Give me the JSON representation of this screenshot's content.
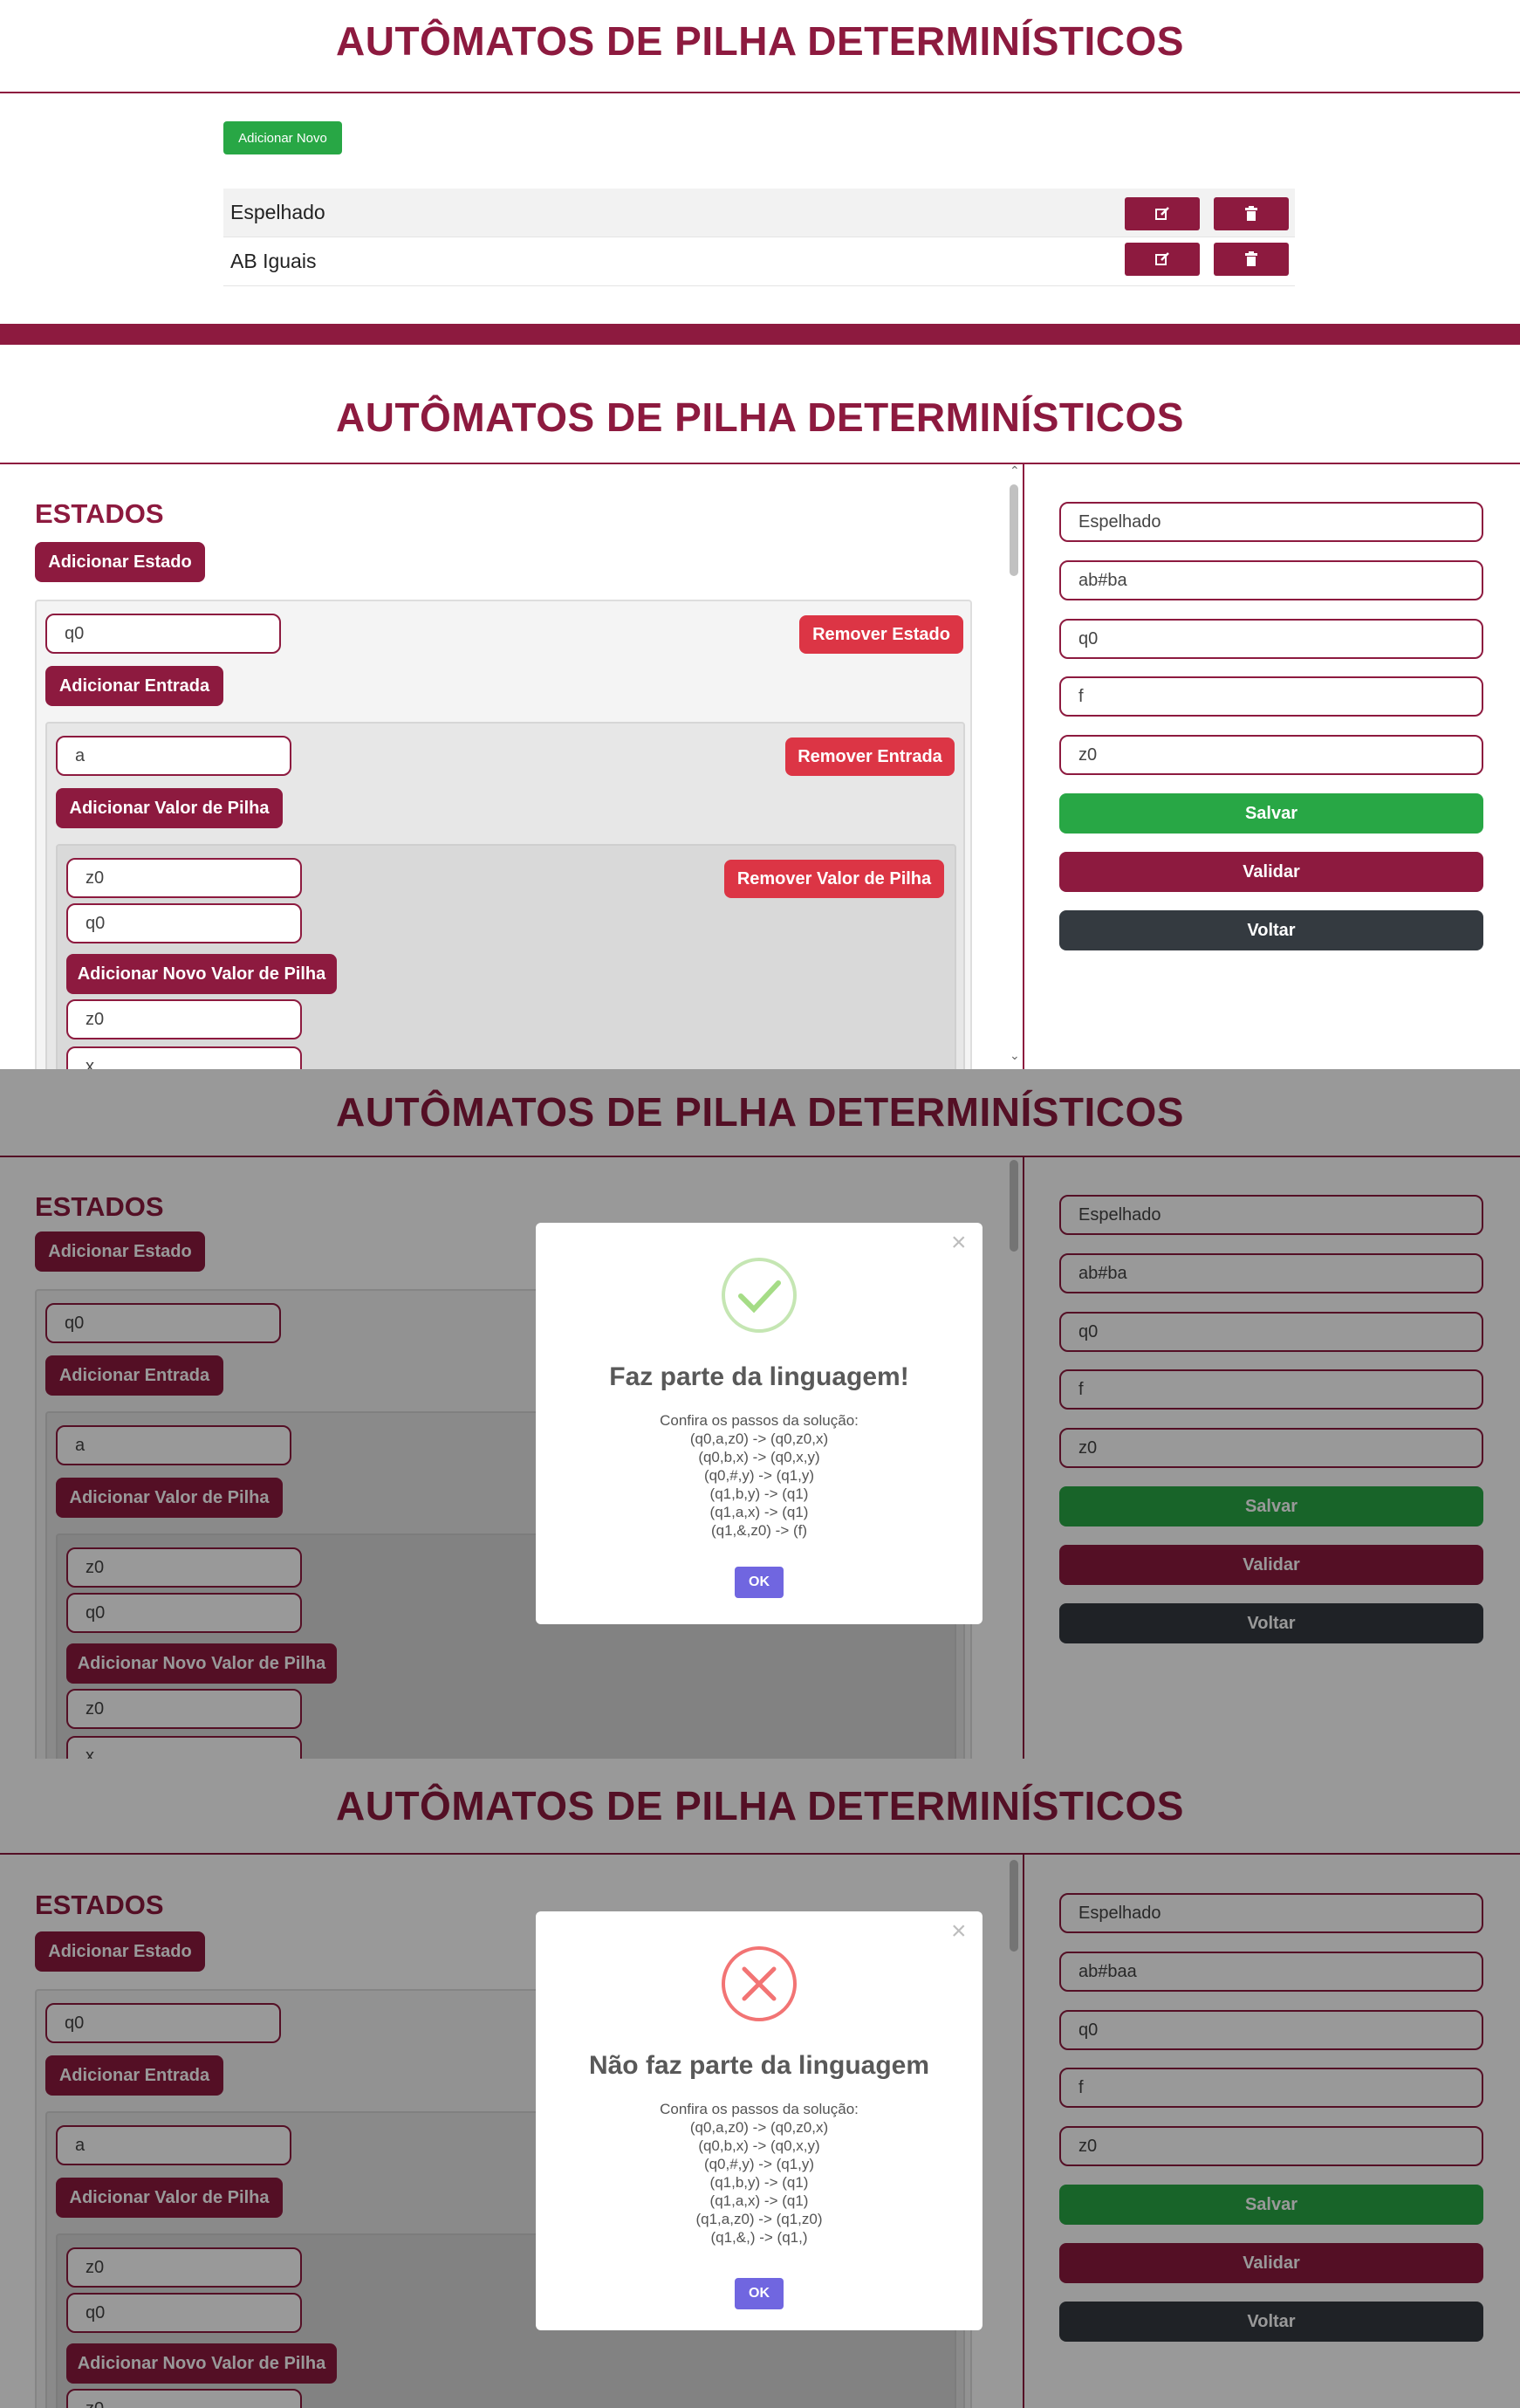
{
  "app_title": "AUTÔMATOS DE PILHA DETERMINÍSTICOS",
  "list": {
    "add_new_label": "Adicionar Novo",
    "items": [
      {
        "name": "Espelhado"
      },
      {
        "name": "AB Iguais"
      }
    ]
  },
  "editor": {
    "states_heading": "ESTADOS",
    "add_state_label": "Adicionar Estado",
    "remove_state_label": "Remover Estado",
    "add_input_label": "Adicionar Entrada",
    "remove_input_label": "Remover Entrada",
    "add_stack_value_label": "Adicionar Valor de Pilha",
    "remove_stack_value_label": "Remover Valor de Pilha",
    "add_new_stack_value_label": "Adicionar Novo Valor de Pilha",
    "state_value": "q0",
    "input_value": "a",
    "stack_values": [
      "z0",
      "q0",
      "z0",
      "x"
    ]
  },
  "form": {
    "name": "Espelhado",
    "word": "ab#ba",
    "word_invalid": "ab#baa",
    "initial_state": "q0",
    "final_state": "f",
    "stack_start": "z0",
    "save_label": "Salvar",
    "validate_label": "Validar",
    "back_label": "Voltar"
  },
  "modal_success": {
    "title": "Faz parte da linguagem!",
    "subtitle": "Confira os passos da solução:",
    "steps": [
      "(q0,a,z0) -> (q0,z0,x)",
      "(q0,b,x) -> (q0,x,y)",
      "(q0,#,y) -> (q1,y)",
      "(q1,b,y) -> (q1)",
      "(q1,a,x) -> (q1)",
      "(q1,&,z0) -> (f)"
    ],
    "ok_label": "OK",
    "close_glyph": "×"
  },
  "modal_error": {
    "title": "Não faz parte da linguagem",
    "subtitle": "Confira os passos da solução:",
    "steps": [
      "(q0,a,z0) -> (q0,z0,x)",
      "(q0,b,x) -> (q0,x,y)",
      "(q0,#,y) -> (q1,y)",
      "(q1,b,y) -> (q1)",
      "(q1,a,x) -> (q1)",
      "(q1,a,z0) -> (q1,z0)",
      "(q1,&,) -> (q1,)"
    ],
    "ok_label": "OK",
    "close_glyph": "×"
  },
  "colors": {
    "primary": "#8d1a3f",
    "danger": "#dc3545",
    "success": "#28a745",
    "dark": "#343a40",
    "ok_button": "#7066e0"
  }
}
